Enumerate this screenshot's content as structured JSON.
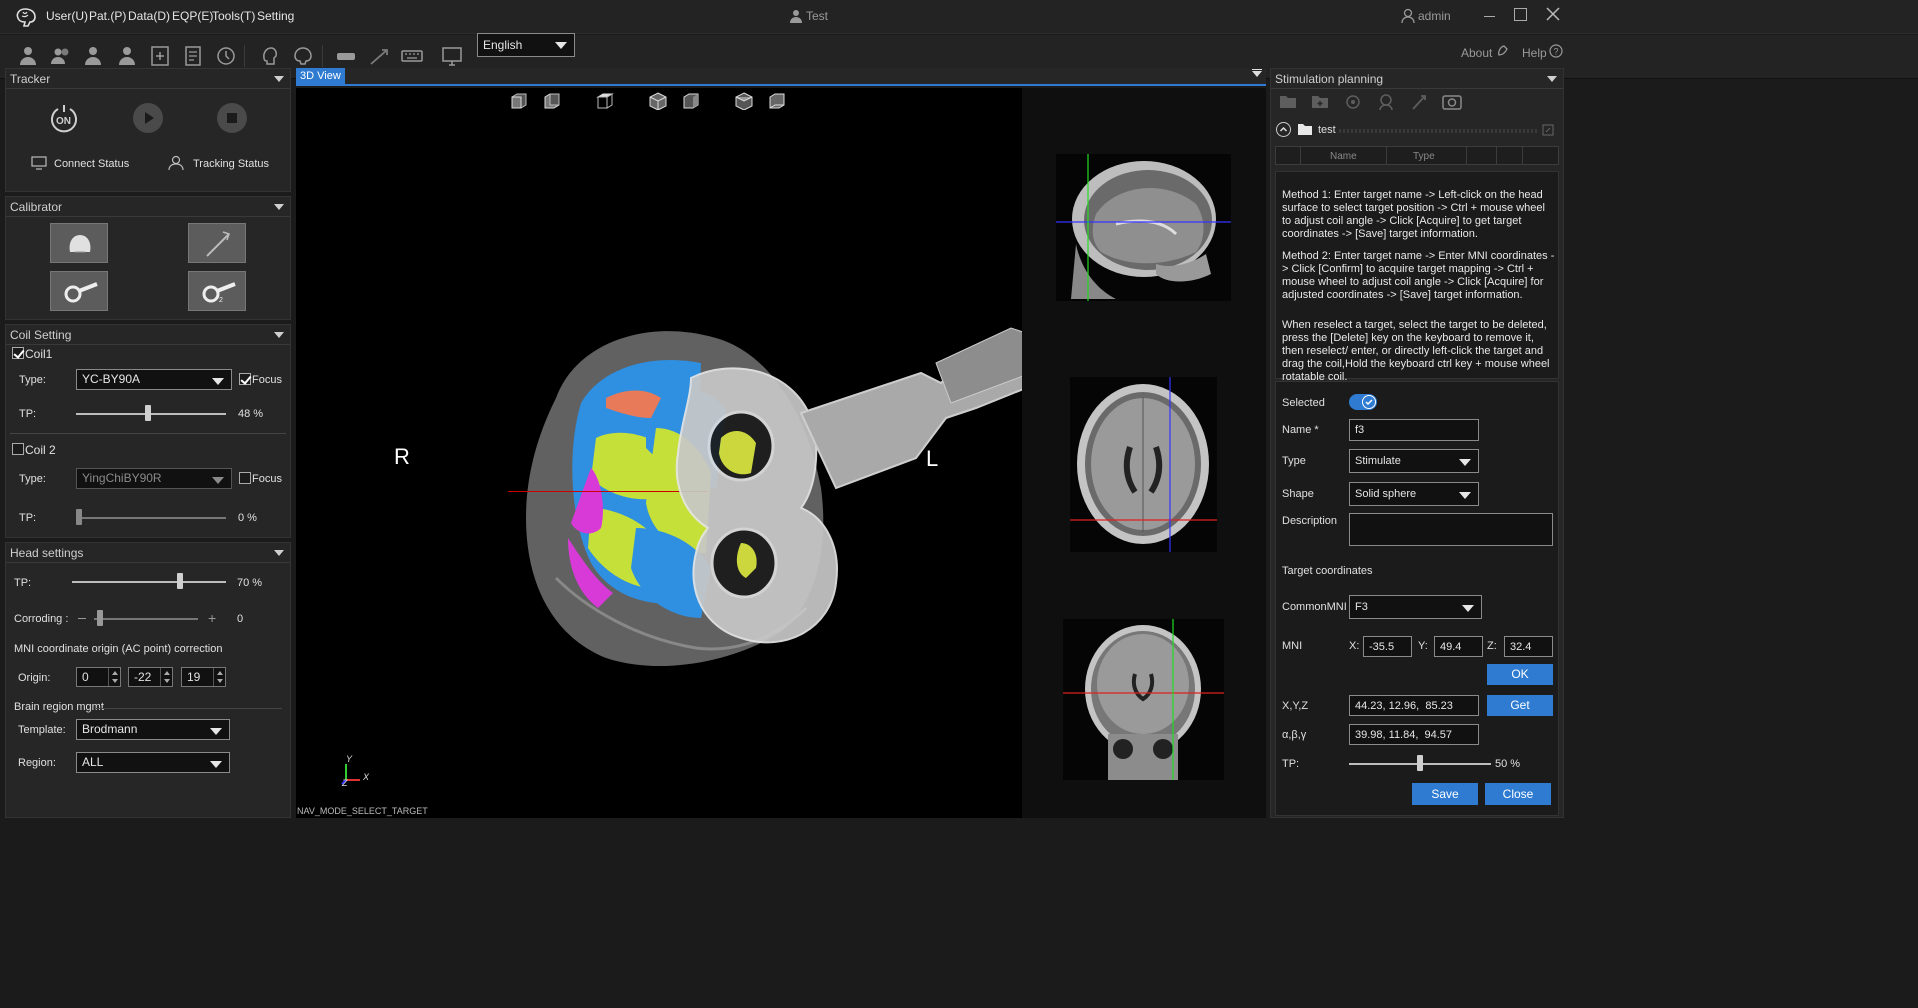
{
  "menubar": {
    "menus": [
      "User(U)",
      "Pat.(P)",
      "Data(D)",
      "EQP(E)",
      "Tools(T)",
      "Setting"
    ],
    "patient_name": "Test",
    "user": "admin"
  },
  "toolbar": {
    "language": "English",
    "about": "About",
    "help": "Help"
  },
  "tracker": {
    "title": "Tracker",
    "on_label": "ON",
    "connect_status": "Connect Status",
    "tracking_status": "Tracking Status"
  },
  "calibrator": {
    "title": "Calibrator"
  },
  "coil_setting": {
    "title": "Coil Setting",
    "coil1": {
      "label": "Coil1",
      "checked": true,
      "type_label": "Type:",
      "type": "YC-BY90A",
      "focus_label": "Focus",
      "focus_checked": true,
      "tp_label": "TP:",
      "tp_value": "48 %",
      "tp": 48
    },
    "coil2": {
      "label": "Coil 2",
      "checked": false,
      "type_label": "Type:",
      "type": "YingChiBY90R",
      "focus_label": "Focus",
      "focus_checked": false,
      "tp_label": "TP:",
      "tp_value": "0 %",
      "tp": 0
    }
  },
  "head_settings": {
    "title": "Head settings",
    "tp_label": "TP:",
    "tp_value": "70 %",
    "tp": 70,
    "corroding_label": "Corroding :",
    "corroding_value": "0",
    "mni_title": "MNI coordinate origin (AC point) correction",
    "origin_label": "Origin:",
    "origin": [
      "0",
      "-22",
      "19"
    ],
    "brain_region_title": "Brain region mgmt",
    "template_label": "Template:",
    "template": "Brodmann",
    "region_label": "Region:",
    "region": "ALL"
  },
  "view3d": {
    "tab": "3D View",
    "left_label": "R",
    "right_label": "L",
    "axis_y": "Y",
    "axis_x": "X",
    "axis_z": "Z",
    "status": "NAV_MODE_SELECT_TARGET"
  },
  "stim": {
    "title": "Stimulation planning",
    "folder": "test",
    "col_name": "Name",
    "col_type": "Type",
    "method1": "Method 1: Enter target name -> Left-click on the head surface to select target position -> Ctrl + mouse wheel to adjust coil angle -> Click [Acquire] to get target coordinates -> [Save] target information.",
    "method2": "Method 2: Enter target name -> Enter MNI coordinates -> Click [Confirm] to acquire target mapping -> Ctrl + mouse wheel to adjust coil angle -> Click [Acquire] for adjusted coordinates -> [Save] target information.",
    "method3": "When reselect a target, select the target to be deleted, press the [Delete] key on the keyboard to remove it, then reselect/ enter, or directly left-click the target and drag the coil,Hold the keyboard ctrl key + mouse wheel rotatable coil.",
    "selected_label": "Selected",
    "name_label": "Name *",
    "name": "f3",
    "type_label": "Type",
    "type": "Stimulate",
    "shape_label": "Shape",
    "shape": "Solid sphere",
    "description_label": "Description",
    "description": "",
    "target_coords_label": "Target coordinates",
    "common_mni_label": "CommonMNI",
    "common_mni": "F3",
    "mni_label": "MNI",
    "x_label": "X:",
    "x": "-35.5",
    "y_label": "Y:",
    "y": "49.4",
    "z_label": "Z:",
    "z": "32.4",
    "ok": "OK",
    "xyz_label": "X,Y,Z",
    "xyz": "44.23, 12.96,  85.23",
    "get": "Get",
    "abg_label": "α,β,γ",
    "abg": "39.98, 11.84,  94.57",
    "tp_label": "TP:",
    "tp_value": "50 %",
    "tp": 50,
    "save": "Save",
    "close": "Close"
  }
}
